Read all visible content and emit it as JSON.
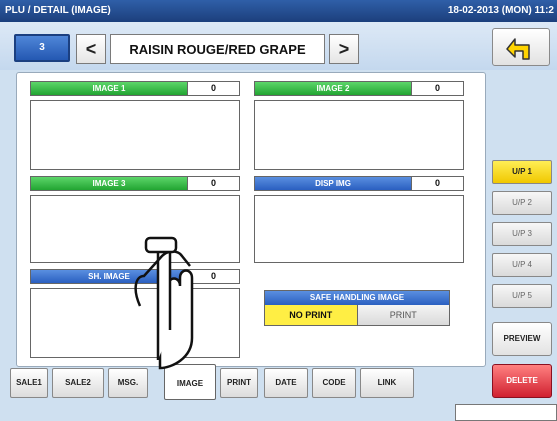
{
  "title": "PLU / DETAIL (IMAGE)",
  "datetime": "18-02-2013 (MON) 11:2",
  "plu": {
    "number": "3",
    "name": "RAISIN ROUGE/RED GRAPE",
    "prev": "<",
    "next": ">"
  },
  "fields": {
    "image1": {
      "label": "IMAGE 1",
      "value": "0"
    },
    "image2": {
      "label": "IMAGE 2",
      "value": "0"
    },
    "image3": {
      "label": "IMAGE 3",
      "value": "0"
    },
    "disp_img": {
      "label": "DISP IMG",
      "value": "0"
    },
    "sh_image": {
      "label": "SH. IMAGE",
      "value": "0"
    }
  },
  "safe_handling": {
    "title": "SAFE HANDLING IMAGE",
    "no_print": "NO PRINT",
    "print": "PRINT",
    "selected": "NO PRINT"
  },
  "tabs": [
    "SALE1",
    "SALE2",
    "MSG.",
    "IMAGE",
    "PRINT",
    "DATE",
    "CODE",
    "LINK"
  ],
  "active_tab": "IMAGE",
  "up_buttons": [
    "U/P 1",
    "U/P 2",
    "U/P 3",
    "U/P 4",
    "U/P 5"
  ],
  "active_up": "U/P 1",
  "preview": "PREVIEW",
  "delete": "DELETE",
  "colors": {
    "title_bar": "#1c3f7c",
    "green_label": "#22a432",
    "blue_label": "#2a5fc0",
    "selected_yellow": "#ffee44",
    "delete_red": "#d02030"
  },
  "icons": {
    "back": "return-arrow-icon",
    "pointer": "pointing-hand-icon"
  }
}
